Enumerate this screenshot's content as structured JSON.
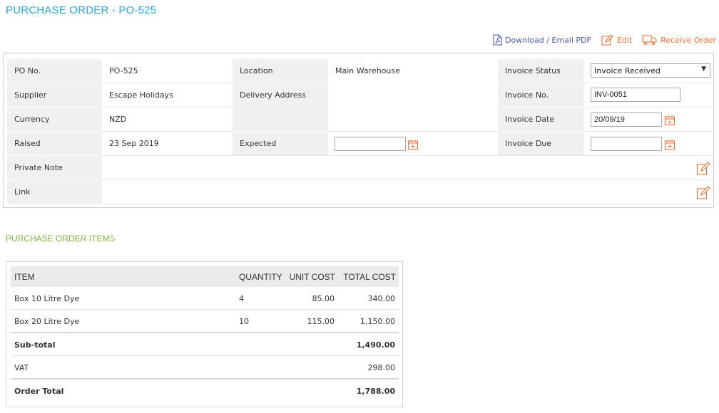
{
  "page": {
    "title": "PURCHASE ORDER - PO-525"
  },
  "actions": {
    "download_label": "Download / Email PDF",
    "edit_label": "Edit",
    "receive_label": "Receive Order",
    "icon_colors": {
      "pdf": "#4b5ea8",
      "orange": "#e8743b"
    }
  },
  "details": {
    "po_no_label": "PO No.",
    "po_no": "PO-525",
    "location_label": "Location",
    "location": "Main Warehouse",
    "invoice_status_label": "Invoice Status",
    "invoice_status": "Invoice Received",
    "supplier_label": "Supplier",
    "supplier": "Escape Holidays",
    "delivery_address_label": "Delivery Address",
    "delivery_address": "",
    "invoice_no_label": "Invoice No.",
    "invoice_no": "INV-0051",
    "currency_label": "Currency",
    "currency": "NZD",
    "invoice_date_label": "Invoice Date",
    "invoice_date": "20/09/19",
    "raised_label": "Raised",
    "raised": "23 Sep 2019",
    "expected_label": "Expected",
    "expected": "",
    "invoice_due_label": "Invoice Due",
    "invoice_due": "",
    "private_note_label": "Private Note",
    "private_note": "",
    "link_label": "Link",
    "link": ""
  },
  "items_section": {
    "title": "PURCHASE ORDER ITEMS",
    "headers": {
      "item": "ITEM",
      "quantity": "QUANTITY",
      "unit_cost": "UNIT COST",
      "total_cost": "TOTAL COST"
    },
    "rows": [
      {
        "item": "Box 10 Litre Dye",
        "quantity": "4",
        "unit_cost": "85.00",
        "total_cost": "340.00"
      },
      {
        "item": "Box 20 Litre Dye",
        "quantity": "10",
        "unit_cost": "115.00",
        "total_cost": "1,150.00"
      }
    ],
    "subtotal_label": "Sub-total",
    "subtotal": "1,490.00",
    "vat_label": "VAT",
    "vat": "298.00",
    "order_total_label": "Order Total",
    "order_total": "1,788.00"
  },
  "colors": {
    "title_blue": "#2aa7d9",
    "section_green": "#7fb545",
    "accent_orange": "#e8743b"
  }
}
